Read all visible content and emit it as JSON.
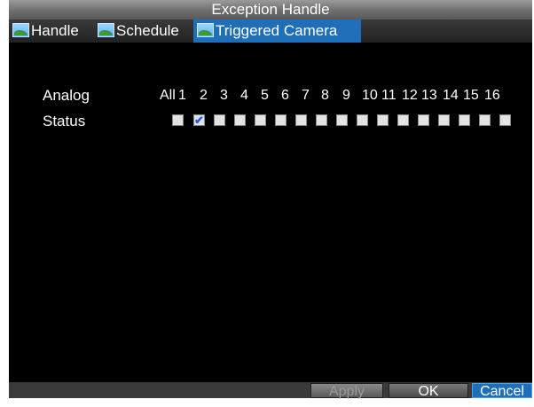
{
  "window": {
    "title": "Exception Handle"
  },
  "tabs": [
    {
      "label": "Handle",
      "icon": "picture-icon"
    },
    {
      "label": "Schedule",
      "icon": "picture-icon"
    },
    {
      "label": "Triggered Camera",
      "icon": "picture-icon",
      "active": true
    }
  ],
  "rows": {
    "analog_label": "Analog",
    "status_label": "Status"
  },
  "channels": [
    "All",
    "1",
    "2",
    "3",
    "4",
    "5",
    "6",
    "7",
    "8",
    "9",
    "10",
    "11",
    "12",
    "13",
    "14",
    "15",
    "16"
  ],
  "status_checked": [
    false,
    true,
    false,
    false,
    false,
    false,
    false,
    false,
    false,
    false,
    false,
    false,
    false,
    false,
    false,
    false,
    false
  ],
  "buttons": {
    "apply": "Apply",
    "ok": "OK",
    "cancel": "Cancel"
  },
  "colors": {
    "accent": "#1e6fb7",
    "background": "#000000"
  }
}
